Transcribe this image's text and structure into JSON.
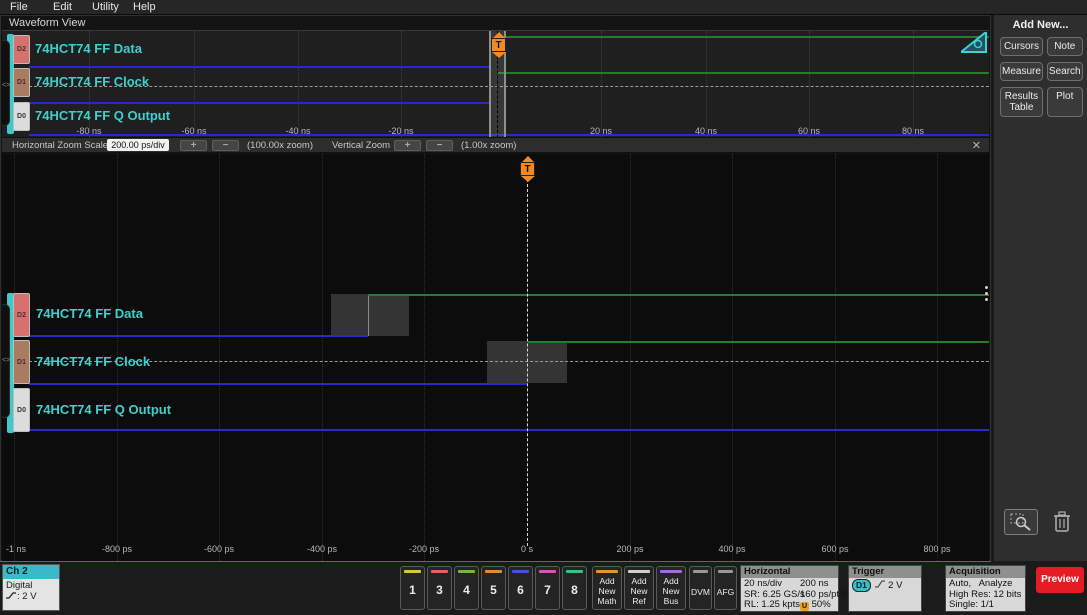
{
  "menu": {
    "items": [
      "File",
      "Edit",
      "Utility",
      "Help"
    ]
  },
  "waveform_view": {
    "tab_label": "Waveform View",
    "channels": [
      {
        "badge": "D2",
        "label": "74HCT74 FF Data",
        "color": "#d97070"
      },
      {
        "badge": "D1",
        "label": "74HCT74 FF Clock",
        "color": "#a97b61"
      },
      {
        "badge": "D0",
        "label": "74HCT74 FF Q Output",
        "color": "#dcdcdc"
      }
    ],
    "trigger_source_marker": "<>",
    "trigger_label": "T",
    "overview_ticks": [
      "-80 ns",
      "-60 ns",
      "-40 ns",
      "-20 ns",
      "20 ns",
      "40 ns",
      "60 ns",
      "80 ns"
    ],
    "zoom_ticks": [
      "-1 ns",
      "-800 ps",
      "-600 ps",
      "-400 ps",
      "-200 ps",
      "0 s",
      "200 ps",
      "400 ps",
      "600 ps",
      "800 ps"
    ],
    "waveforms": {
      "data": {
        "level": "low then high",
        "transition_at": "-300 ps"
      },
      "clock": {
        "level": "low then high",
        "transition_at": "0 s"
      },
      "q_output": {
        "level": "low"
      }
    }
  },
  "zoom_bar": {
    "h_label": "Horizontal Zoom Scale",
    "h_scale": "200.00 ps/div",
    "plus": "+",
    "minus": "−",
    "h_zoom": "(100.00x zoom)",
    "v_label": "Vertical Zoom",
    "v_zoom": "(1.00x zoom)",
    "close": "✕"
  },
  "right_panel": {
    "title": "Add New...",
    "buttons": [
      "Cursors",
      "Note",
      "Measure",
      "Search",
      "Results Table",
      "Plot"
    ]
  },
  "bottom": {
    "channel": {
      "title": "Ch 2",
      "type": "Digital",
      "threshold": ": 2 V"
    },
    "buttons": [
      {
        "label": "1",
        "color": "#d8c83c"
      },
      {
        "label": "3",
        "color": "#e06262"
      },
      {
        "label": "4",
        "color": "#74b842"
      },
      {
        "label": "5",
        "color": "#e08c34"
      },
      {
        "label": "6",
        "color": "#4450e0"
      },
      {
        "label": "7",
        "color": "#d655b8"
      },
      {
        "label": "8",
        "color": "#32c684"
      }
    ],
    "add_buttons": [
      {
        "label": "Add New Math",
        "color": "#e0962e"
      },
      {
        "label": "Add New Ref",
        "color": "#cfcfcf"
      },
      {
        "label": "Add New Bus",
        "color": "#a868d8"
      }
    ],
    "dvm": "DVM",
    "afg": "AFG",
    "horizontal": {
      "title": "Horizontal",
      "scale": "20 ns/div",
      "window": "200 ns",
      "sr": "SR: 6.25 GS/s",
      "res": "160 ps/pt (IT",
      "rl": "RL: 1.25 kpts",
      "pos_icon": "U",
      "pos": "50%"
    },
    "trigger": {
      "title": "Trigger",
      "source": "D1",
      "level": "2 V"
    },
    "acquisition": {
      "title": "Acquisition",
      "mode": "Auto,   Analyze",
      "line2": "High Res: 12 bits",
      "line3": "Single: 1/1"
    },
    "preview": "Preview"
  }
}
